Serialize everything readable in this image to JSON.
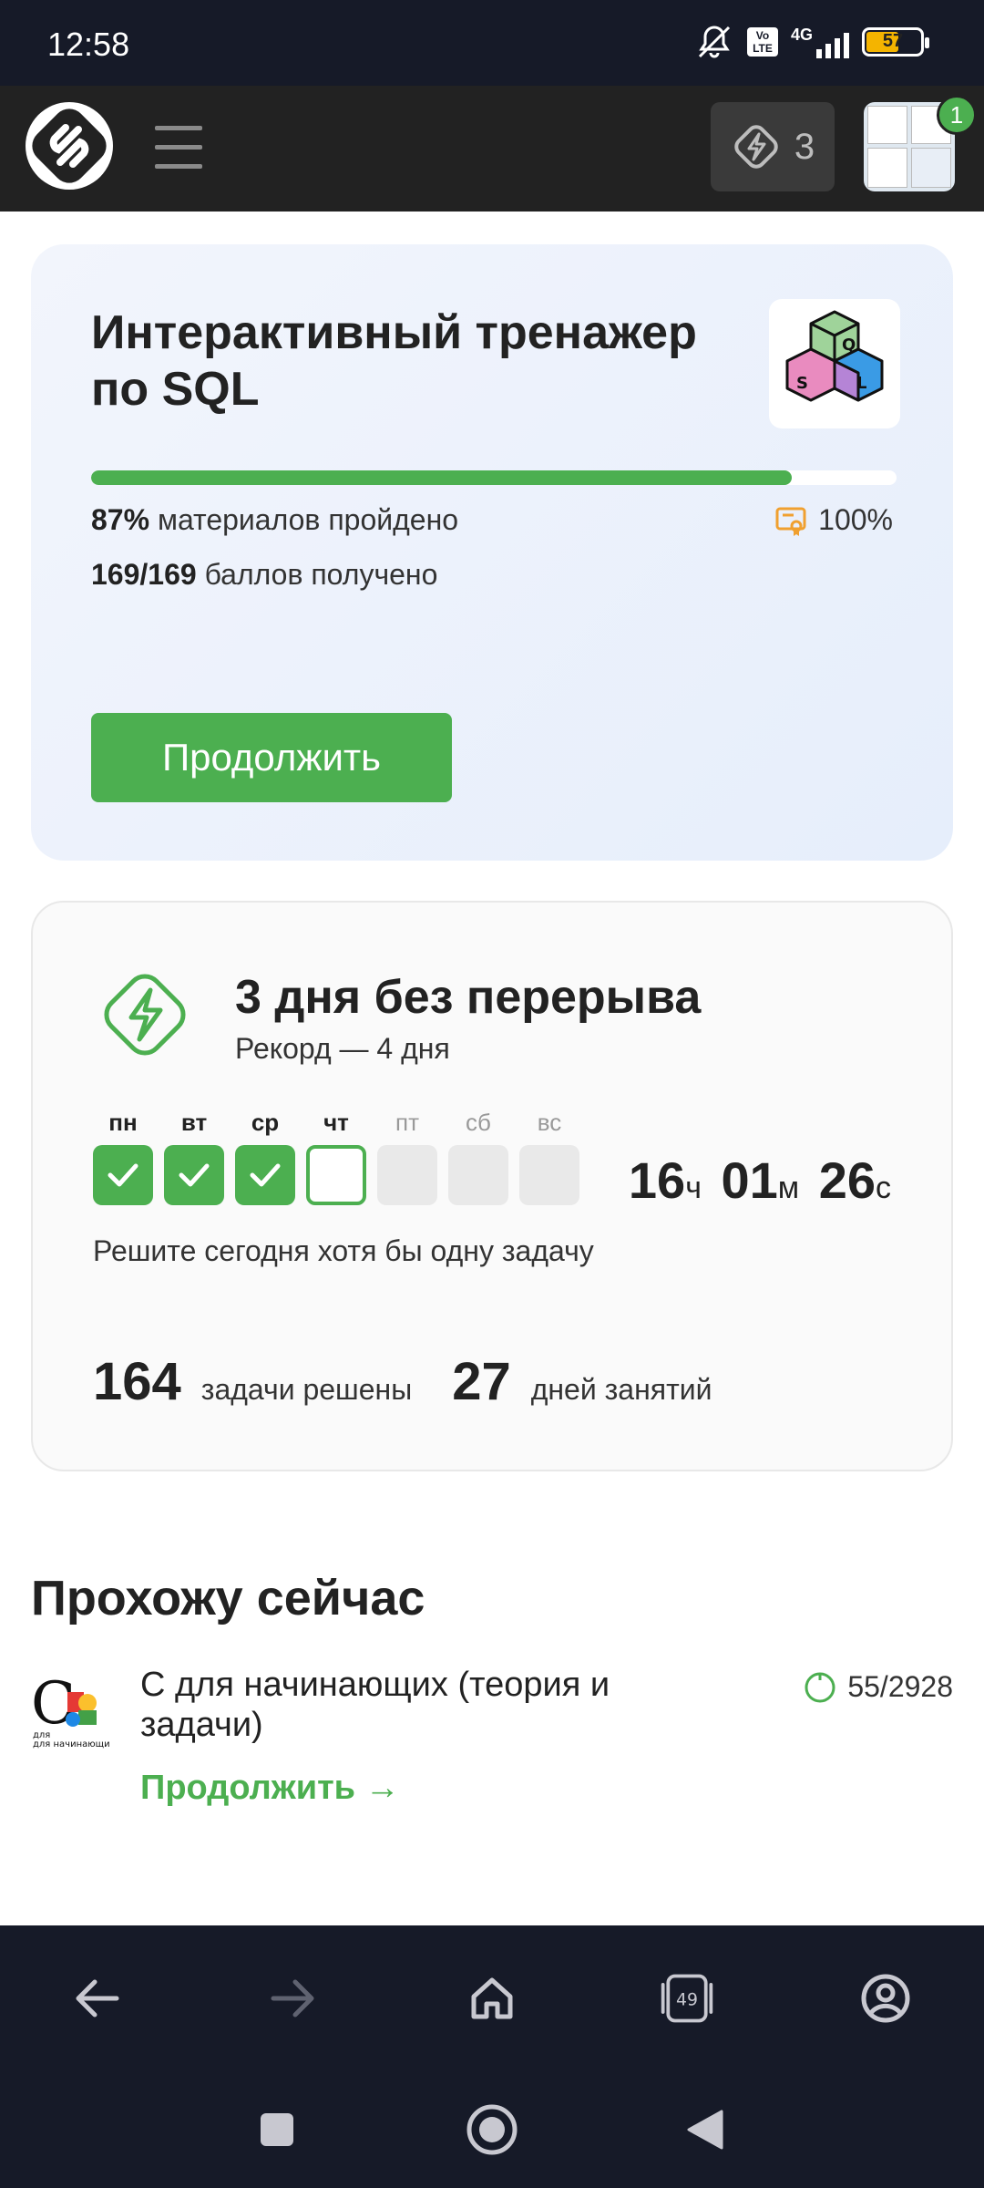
{
  "status_bar": {
    "time": "12:58",
    "network": "4G",
    "volte": "Vo LTE",
    "battery": "57"
  },
  "header": {
    "energy_count": "3",
    "notifications": "1"
  },
  "course_card": {
    "title": "Интерактивный тренажер по SQL",
    "progress_percent": 87,
    "progress_value": "87%",
    "progress_text": "материалов пройдено",
    "certificate_threshold": "100%",
    "points_value": "169/169",
    "points_text": "баллов получено",
    "continue_label": "Продолжить"
  },
  "streak_card": {
    "title": "3 дня без перерыва",
    "record": "Рекорд — 4 дня",
    "days": [
      {
        "label": "пн",
        "state": "done"
      },
      {
        "label": "вт",
        "state": "done"
      },
      {
        "label": "ср",
        "state": "done"
      },
      {
        "label": "чт",
        "state": "today"
      },
      {
        "label": "пт",
        "state": "future"
      },
      {
        "label": "сб",
        "state": "future"
      },
      {
        "label": "вс",
        "state": "future"
      }
    ],
    "timer": {
      "hours": "16",
      "hours_unit": "ч",
      "minutes": "01",
      "minutes_unit": "м",
      "seconds": "26",
      "seconds_unit": "с"
    },
    "hint": "Решите сегодня хотя бы одну задачу",
    "tasks_solved": "164",
    "tasks_solved_label": "задачи решены",
    "study_days": "27",
    "study_days_label": "дней занятий"
  },
  "now_studying": {
    "section_title": "Прохожу сейчас",
    "course_name": "С для начинающих (теория и задачи)",
    "progress": "55/2928",
    "continue_label": "Продолжить →",
    "thumb_text": "для начинающих"
  },
  "colors": {
    "accent": "#4caf50",
    "header_bg": "#222222",
    "system_bar": "#161a28"
  },
  "browser_bar": {
    "tabs_count": "49",
    "icons": [
      "back-arrow-icon",
      "forward-arrow-icon",
      "home-icon",
      "tabs-icon",
      "account-icon"
    ]
  },
  "system_nav": {
    "icons": [
      "recents-square-icon",
      "home-circle-icon",
      "back-triangle-icon"
    ]
  }
}
